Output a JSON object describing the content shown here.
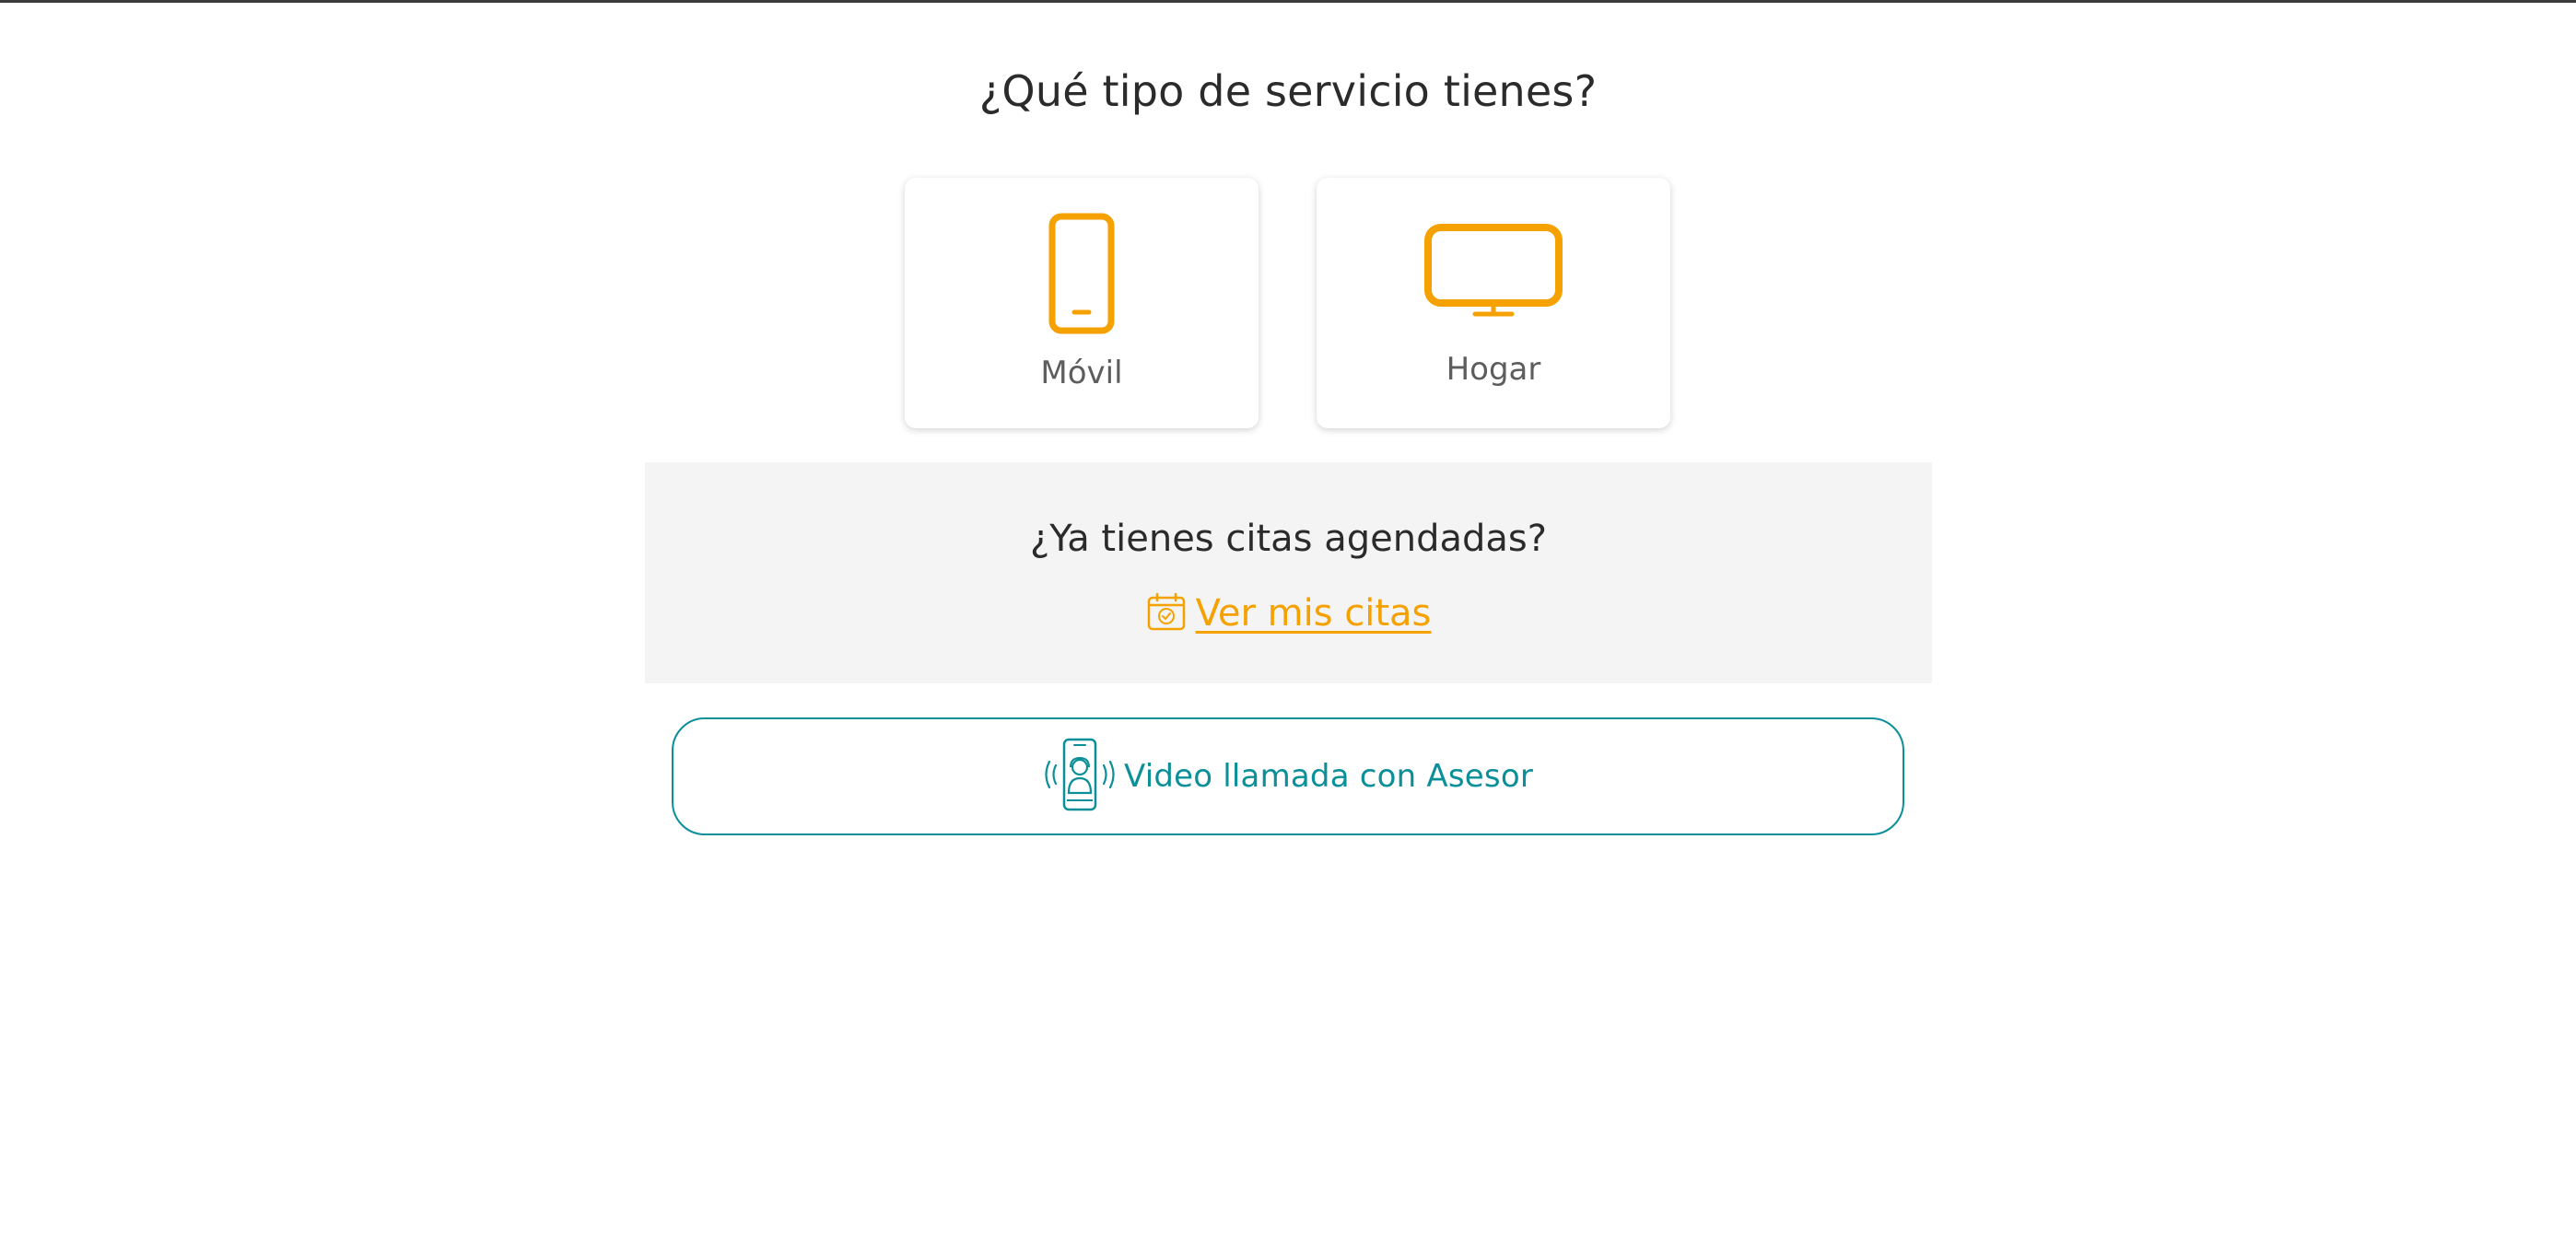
{
  "page": {
    "title": "¿Qué tipo de servicio tienes?"
  },
  "services": {
    "movil": {
      "label": "Móvil",
      "icon": "mobile-phone-icon"
    },
    "hogar": {
      "label": "Hogar",
      "icon": "tv-monitor-icon"
    }
  },
  "appointments": {
    "question": "¿Ya tienes citas agendadas?",
    "link_label": " Ver mis citas",
    "icon": "calendar-check-icon"
  },
  "video_call": {
    "label": "Video llamada con Asesor",
    "icon": "video-call-advisor-icon"
  },
  "colors": {
    "accent_orange": "#f5a100",
    "accent_teal": "#0b8f99",
    "panel_bg": "#f4f4f4",
    "text_dark": "#2b2b2b",
    "text_gray": "#5d5d5d"
  }
}
